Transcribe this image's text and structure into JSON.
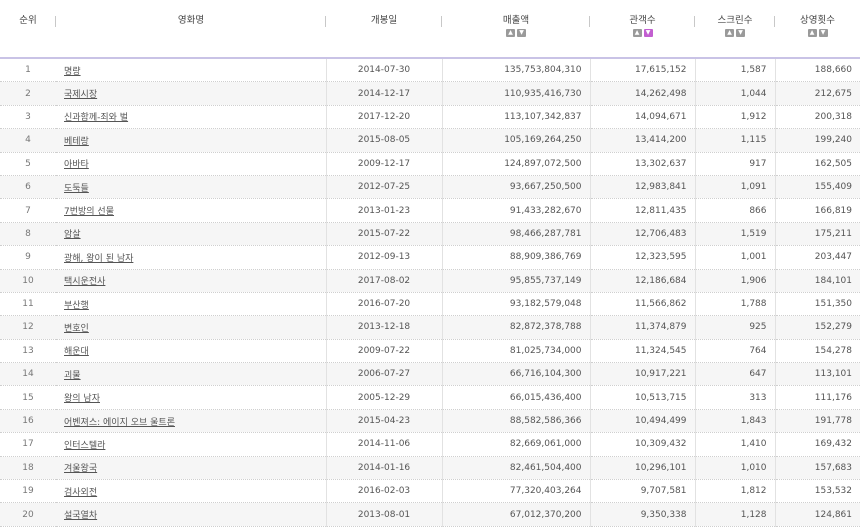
{
  "headers": {
    "rank": "순위",
    "title": "영화명",
    "release_date": "개봉일",
    "sales": "매출액",
    "audience": "관객수",
    "screens": "스크린수",
    "showings": "상영횟수"
  },
  "colors": {
    "sort_active": "#c25fd0",
    "sort_inactive": "#9a9a9a",
    "header_border": "#c9c3e6"
  },
  "rows": [
    {
      "rank": "1",
      "title": "명량",
      "date": "2014-07-30",
      "sales": "135,753,804,310",
      "audience": "17,615,152",
      "screens": "1,587",
      "showings": "188,660"
    },
    {
      "rank": "2",
      "title": "국제시장",
      "date": "2014-12-17",
      "sales": "110,935,416,730",
      "audience": "14,262,498",
      "screens": "1,044",
      "showings": "212,675"
    },
    {
      "rank": "3",
      "title": "신과함께-죄와 벌",
      "date": "2017-12-20",
      "sales": "113,107,342,837",
      "audience": "14,094,671",
      "screens": "1,912",
      "showings": "200,318"
    },
    {
      "rank": "4",
      "title": "베테랑",
      "date": "2015-08-05",
      "sales": "105,169,264,250",
      "audience": "13,414,200",
      "screens": "1,115",
      "showings": "199,240"
    },
    {
      "rank": "5",
      "title": "아바타",
      "date": "2009-12-17",
      "sales": "124,897,072,500",
      "audience": "13,302,637",
      "screens": "917",
      "showings": "162,505"
    },
    {
      "rank": "6",
      "title": "도둑들",
      "date": "2012-07-25",
      "sales": "93,667,250,500",
      "audience": "12,983,841",
      "screens": "1,091",
      "showings": "155,409"
    },
    {
      "rank": "7",
      "title": "7번방의 선물",
      "date": "2013-01-23",
      "sales": "91,433,282,670",
      "audience": "12,811,435",
      "screens": "866",
      "showings": "166,819"
    },
    {
      "rank": "8",
      "title": "암살",
      "date": "2015-07-22",
      "sales": "98,466,287,781",
      "audience": "12,706,483",
      "screens": "1,519",
      "showings": "175,211"
    },
    {
      "rank": "9",
      "title": "광해, 왕이 된 남자",
      "date": "2012-09-13",
      "sales": "88,909,386,769",
      "audience": "12,323,595",
      "screens": "1,001",
      "showings": "203,447"
    },
    {
      "rank": "10",
      "title": "택시운전사",
      "date": "2017-08-02",
      "sales": "95,855,737,149",
      "audience": "12,186,684",
      "screens": "1,906",
      "showings": "184,101"
    },
    {
      "rank": "11",
      "title": "부산행",
      "date": "2016-07-20",
      "sales": "93,182,579,048",
      "audience": "11,566,862",
      "screens": "1,788",
      "showings": "151,350"
    },
    {
      "rank": "12",
      "title": "변호인",
      "date": "2013-12-18",
      "sales": "82,872,378,788",
      "audience": "11,374,879",
      "screens": "925",
      "showings": "152,279"
    },
    {
      "rank": "13",
      "title": "해운대",
      "date": "2009-07-22",
      "sales": "81,025,734,000",
      "audience": "11,324,545",
      "screens": "764",
      "showings": "154,278"
    },
    {
      "rank": "14",
      "title": "괴물",
      "date": "2006-07-27",
      "sales": "66,716,104,300",
      "audience": "10,917,221",
      "screens": "647",
      "showings": "113,101"
    },
    {
      "rank": "15",
      "title": "왕의 남자",
      "date": "2005-12-29",
      "sales": "66,015,436,400",
      "audience": "10,513,715",
      "screens": "313",
      "showings": "111,176"
    },
    {
      "rank": "16",
      "title": "어벤져스: 에이지 오브 울트론",
      "date": "2015-04-23",
      "sales": "88,582,586,366",
      "audience": "10,494,499",
      "screens": "1,843",
      "showings": "191,778"
    },
    {
      "rank": "17",
      "title": "인터스텔라",
      "date": "2014-11-06",
      "sales": "82,669,061,000",
      "audience": "10,309,432",
      "screens": "1,410",
      "showings": "169,432"
    },
    {
      "rank": "18",
      "title": "겨울왕국",
      "date": "2014-01-16",
      "sales": "82,461,504,400",
      "audience": "10,296,101",
      "screens": "1,010",
      "showings": "157,683"
    },
    {
      "rank": "19",
      "title": "검사외전",
      "date": "2016-02-03",
      "sales": "77,320,403,264",
      "audience": "9,707,581",
      "screens": "1,812",
      "showings": "153,532"
    },
    {
      "rank": "20",
      "title": "설국열차",
      "date": "2013-08-01",
      "sales": "67,012,370,200",
      "audience": "9,350,338",
      "screens": "1,128",
      "showings": "124,861"
    }
  ]
}
